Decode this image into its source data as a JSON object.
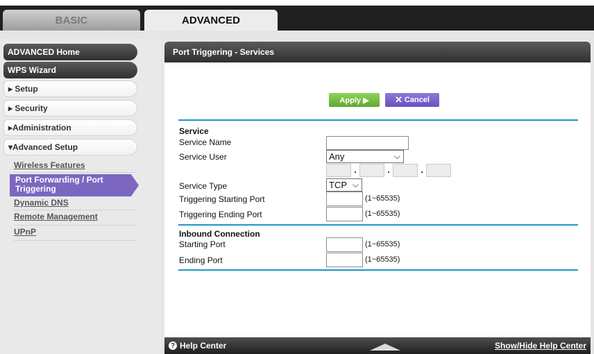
{
  "tabs": {
    "basic": "BASIC",
    "advanced": "ADVANCED"
  },
  "sidebar": {
    "advanced_home": "ADVANCED Home",
    "wps_wizard": "WPS Wizard",
    "setup": "▸ Setup",
    "security": "▸ Security",
    "administration": "▸Administration",
    "advanced_setup": "▾Advanced Setup",
    "subitems": {
      "wireless": "Wireless Features",
      "port_forwarding": "Port Forwarding / Port Triggering",
      "ddns": "Dynamic DNS",
      "remote": "Remote Management",
      "upnp": "UPnP"
    }
  },
  "panel": {
    "title": "Port Triggering - Services"
  },
  "buttons": {
    "apply": "Apply ▶",
    "cancel": "Cancel"
  },
  "form": {
    "service_section": "Service",
    "service_name_label": "Service Name",
    "service_name_value": "",
    "service_user_label": "Service User",
    "service_user_value": "Any",
    "service_type_label": "Service Type",
    "service_type_value": "TCP",
    "trig_start_label": "Triggering Starting Port",
    "trig_end_label": "Triggering Ending Port",
    "inbound_section": "Inbound Connection",
    "start_port_label": "Starting Port",
    "end_port_label": "Ending Port",
    "range_text": "(1~65535)"
  },
  "footer": {
    "help": "Help Center",
    "toggle": "Show/Hide Help Center"
  }
}
